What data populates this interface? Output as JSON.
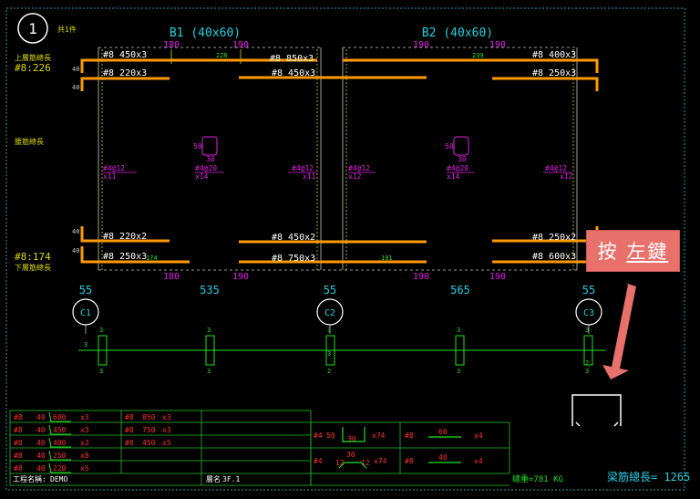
{
  "drawing": {
    "beam_number": "1",
    "beam_number_suffix": "共1件",
    "top_label": "上層筋總長",
    "top_value": "#8:226",
    "web_label": "腰筋總長",
    "bottom_value": "#8:174",
    "bottom_label": "下層筋總長"
  },
  "beams": [
    {
      "title": "B1 (40x60)",
      "top_left": "180",
      "top_right": "190",
      "bot_left": "180",
      "bot_right": "190"
    },
    {
      "title": "B2 (40x60)",
      "top_left": "190",
      "top_right": "190",
      "bot_left": "",
      "bot_right": "190"
    }
  ],
  "rebar_labels": {
    "t1": "#8 450x3",
    "t2": "#8 850x3",
    "t3": "#8 400x3",
    "t4": "#8 220x3",
    "t5": "#8 450x3",
    "t6": "#8 250x3",
    "b1": "#8 220x2",
    "b2": "#8 450x2",
    "b3": "#8 250x2",
    "b4": "#8 250x3",
    "b5": "#8 750x3",
    "b6": "#8 600x3",
    "mark_top1": "226",
    "mark_top2": "239",
    "mark_bot1": "174",
    "mark_bot2": "191",
    "side40a": "40",
    "side40b": "40",
    "side40c": "40",
    "side40d": "40"
  },
  "stirrups": {
    "s1a": "#4@12",
    "s1b": "x11",
    "s2a": "#4@20",
    "s2b": "x14",
    "s3a": "#4@12",
    "s3b": "x11",
    "s4a": "#4@12",
    "s4b": "x12",
    "s5a": "#4@20",
    "s5b": "x14",
    "s6a": "#4@12",
    "s6b": "x12",
    "ss1": "50",
    "ss1b": "30",
    "ss2": "50",
    "ss2b": "30"
  },
  "spans": {
    "c1w": "55",
    "span1": "535",
    "c2w": "55",
    "span2": "565",
    "c3w": "55"
  },
  "columns": [
    "C1",
    "C2",
    "C3"
  ],
  "tick_labels": {
    "l1": "3",
    "l2": "3",
    "l3": "3",
    "l4": "3",
    "l5": "3",
    "l6": "3",
    "l7": "3",
    "l8": "2",
    "l9": "3",
    "l10": "3",
    "l11": "3",
    "l12": "2",
    "l13": "3"
  },
  "table_left": [
    {
      "bar": "#8",
      "len": "40",
      "size": "600",
      "qty": "x3",
      "bar2": "#8",
      "size2": "850",
      "qty2": "x3"
    },
    {
      "bar": "#8",
      "len": "40",
      "size": "450",
      "qty": "x3",
      "bar2": "#8",
      "size2": "750",
      "qty2": "x3"
    },
    {
      "bar": "#8",
      "len": "40",
      "size": "400",
      "qty": "x3",
      "bar2": "#8",
      "size2": "450",
      "qty2": "x5"
    },
    {
      "bar": "#8",
      "len": "40",
      "size": "250",
      "qty": "x8",
      "bar2": "",
      "size2": "",
      "qty2": ""
    },
    {
      "bar": "#8",
      "len": "40",
      "size": "220",
      "qty": "x5",
      "bar2": "",
      "size2": "",
      "qty2": ""
    }
  ],
  "table_right": [
    {
      "bar": "#4",
      "a": "50",
      "b": "30",
      "qty": "x74",
      "bar2": "#8",
      "size2": "60",
      "qty2": "x4"
    },
    {
      "bar": "#4",
      "a": "12",
      "b": "30",
      "c": "12",
      "qty": "x74",
      "bar2": "#8",
      "size2": "40",
      "qty2": "x4"
    }
  ],
  "footer": {
    "project_label": "工程名稱:",
    "project_value": "DEMO",
    "floor_label": "層名",
    "floor_value": "3F.1",
    "weight": "總重=781 KG",
    "length": "梁筋總長= 1265"
  },
  "callout": {
    "text_a": "按",
    "text_b": "左鍵"
  },
  "colors": {
    "rebar": "#ff9a00",
    "grid": "#00c000",
    "yellow": "#d8d800",
    "cyan": "#20d0e0",
    "magenta": "#e020e0",
    "red": "#ff3030",
    "white": "#ffffff",
    "callout": "#e8716c"
  }
}
